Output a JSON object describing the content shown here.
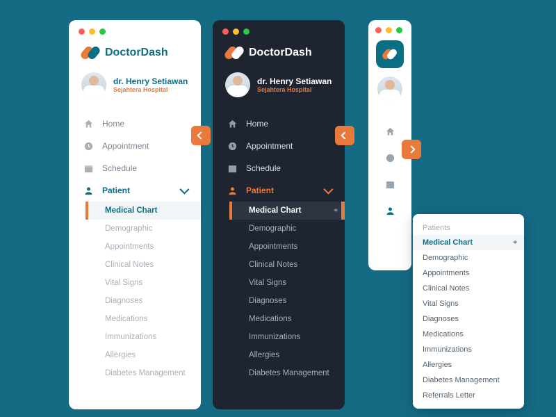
{
  "brand": {
    "name": "DoctorDash"
  },
  "user": {
    "name": "dr. Henry Setiawan",
    "hospital": "Sejahtera Hospital"
  },
  "nav": {
    "items": [
      {
        "label": "Home",
        "icon": "home"
      },
      {
        "label": "Appointment",
        "icon": "clock"
      },
      {
        "label": "Schedule",
        "icon": "calendar"
      },
      {
        "label": "Patient",
        "icon": "person",
        "active": true
      }
    ]
  },
  "patient_submenu": [
    "Medical Chart",
    "Demographic",
    "Appointments",
    "Clinical Notes",
    "Vital Signs",
    "Diagnoses",
    "Medications",
    "Immunizations",
    "Allergies",
    "Diabetes Management"
  ],
  "flyout": {
    "heading": "Patients",
    "items": [
      "Medical Chart",
      "Demographic",
      "Appointments",
      "Clinical Notes",
      "Vital Signs",
      "Diagnoses",
      "Medications",
      "Immunizations",
      "Allergies",
      "Diabetes Management",
      "Referrals Letter"
    ]
  },
  "selected_sub": "Medical Chart",
  "colors": {
    "accent": "#ea7a3b",
    "brand": "#0c6e83",
    "dark": "#1e2430"
  }
}
